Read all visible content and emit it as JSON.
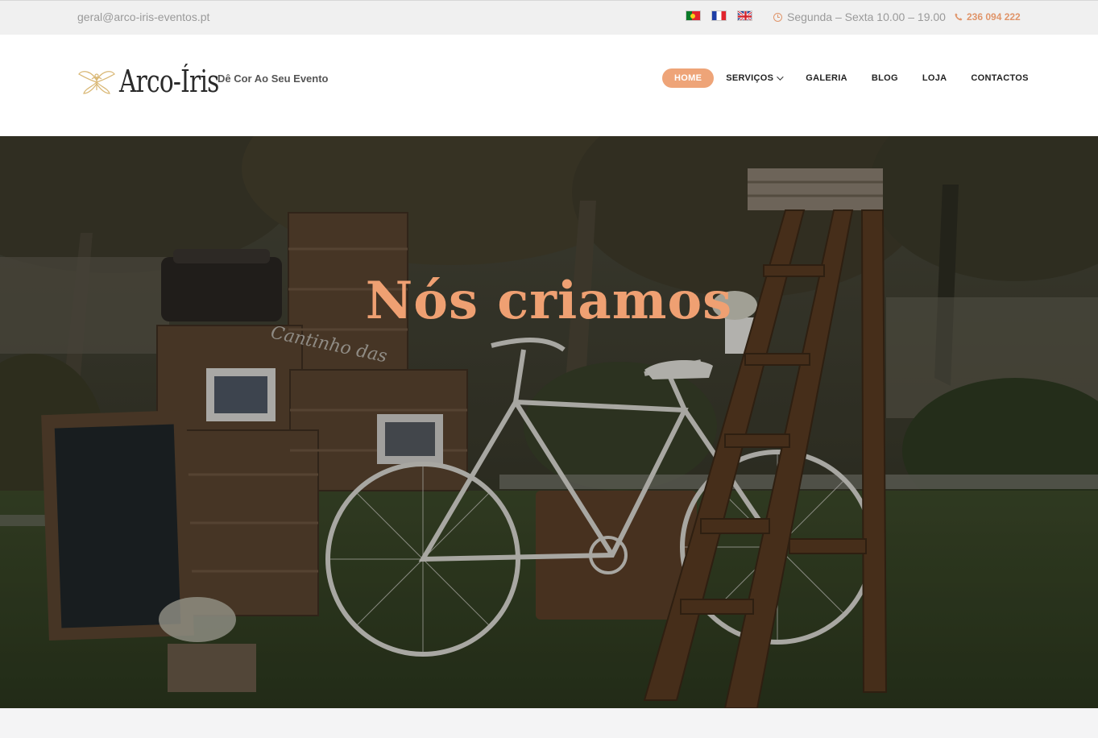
{
  "topbar": {
    "email": "geral@arco-iris-eventos.pt",
    "flags": [
      "flag-pt",
      "flag-fr",
      "flag-gb"
    ],
    "hours": "Segunda – Sexta 10.00 – 19.00",
    "phone": "236 094 222"
  },
  "header": {
    "logo_text": "Arco-Íris",
    "tagline": "Dê Cor Ao Seu Evento"
  },
  "nav": {
    "items": [
      {
        "label": "HOME",
        "active": true
      },
      {
        "label": "SERVIÇOS",
        "dropdown": true
      },
      {
        "label": "GALERIA"
      },
      {
        "label": "BLOG"
      },
      {
        "label": "LOJA"
      },
      {
        "label": "CONTACTOS"
      }
    ]
  },
  "hero": {
    "title": "Nós criamos"
  },
  "colors": {
    "accent": "#eea478",
    "title": "#efa072",
    "topbar_bg": "#f0f0f0"
  },
  "icons": {
    "hours": "clock-icon",
    "phone": "phone-icon",
    "dropdown": "chevron-down-icon"
  }
}
